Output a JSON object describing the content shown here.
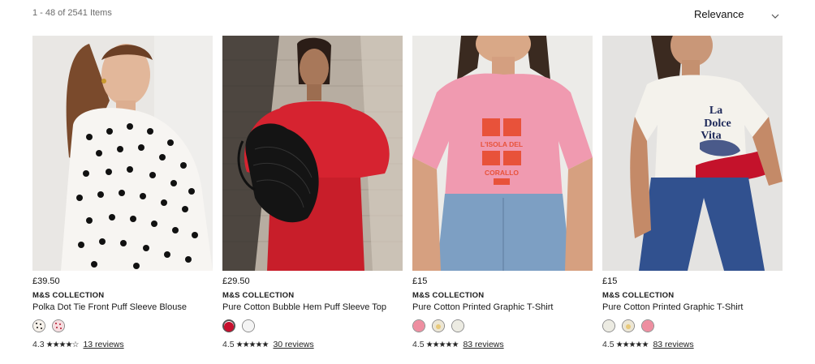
{
  "results": {
    "count_text": "1 - 48 of 2541 Items"
  },
  "sort": {
    "label": "Relevance",
    "icon": "chevron-down-icon"
  },
  "products": [
    {
      "price": "£39.50",
      "brand": "M&S COLLECTION",
      "title": "Polka Dot Tie Front Puff Sleeve Blouse",
      "swatches": [
        {
          "color": "#f6f1ea",
          "pattern": "dots-black"
        },
        {
          "color": "#f6dde0",
          "pattern": "dots-red"
        }
      ],
      "rating_value": "4.3",
      "rating_stars": 4.3,
      "reviews_text": "13 reviews"
    },
    {
      "price": "£29.50",
      "brand": "M&S COLLECTION",
      "title": "Pure Cotton Bubble Hem Puff Sleeve Top",
      "swatches": [
        {
          "color": "#c8102e",
          "pattern": ""
        },
        {
          "color": "#f4f4f4",
          "pattern": ""
        }
      ],
      "rating_value": "4.5",
      "rating_stars": 4.5,
      "reviews_text": "30 reviews"
    },
    {
      "price": "£15",
      "brand": "M&S COLLECTION",
      "title": "Pure Cotton Printed Graphic T-Shirt",
      "swatches": [
        {
          "color": "#ee8ea0",
          "pattern": ""
        },
        {
          "color": "#ece6d4",
          "pattern": "print"
        },
        {
          "color": "#ecebe2",
          "pattern": ""
        }
      ],
      "rating_value": "4.5",
      "rating_stars": 4.5,
      "reviews_text": "83 reviews"
    },
    {
      "price": "£15",
      "brand": "M&S COLLECTION",
      "title": "Pure Cotton Printed Graphic T-Shirt",
      "swatches": [
        {
          "color": "#ecebe2",
          "pattern": ""
        },
        {
          "color": "#ece6d4",
          "pattern": "print"
        },
        {
          "color": "#ee8ea0",
          "pattern": ""
        }
      ],
      "rating_value": "4.5",
      "rating_stars": 4.5,
      "reviews_text": "83 reviews"
    }
  ],
  "image_text": {
    "p3_print_line1": "L'ISOLA DEL",
    "p3_print_line2": "CORALLO",
    "p4_print_line1": "La",
    "p4_print_line2": "Dolce",
    "p4_print_line3": "Vita"
  },
  "colors": {
    "text": "#1a1a1a",
    "muted": "#6b6b6b",
    "accent_red": "#c8102e"
  }
}
